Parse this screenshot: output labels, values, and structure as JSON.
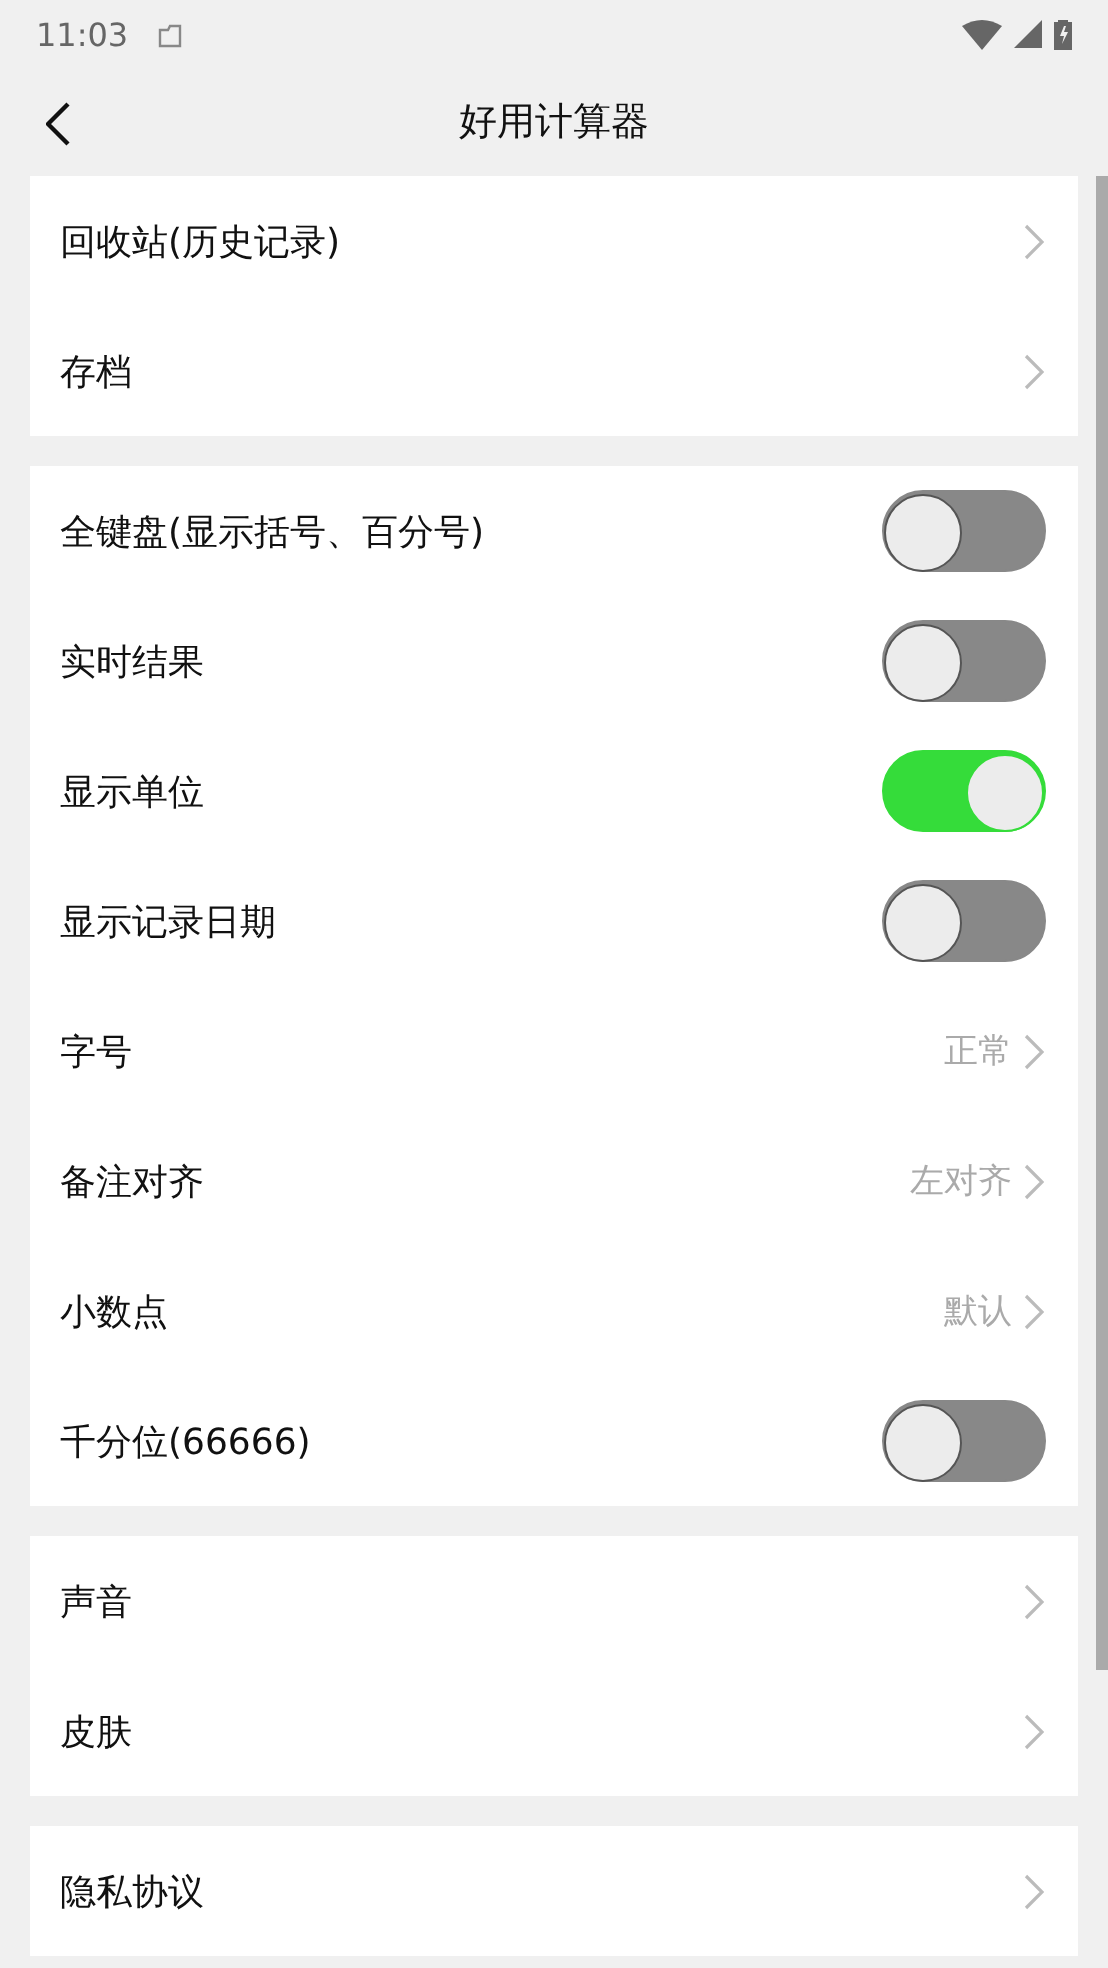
{
  "status_bar": {
    "time": "11:03"
  },
  "header": {
    "title": "好用计算器"
  },
  "groups": [
    {
      "rows": [
        {
          "kind": "link",
          "label": "回收站(历史记录)"
        },
        {
          "kind": "link",
          "label": "存档"
        }
      ]
    },
    {
      "rows": [
        {
          "kind": "toggle",
          "label": "全键盘(显示括号、百分号)",
          "on": false
        },
        {
          "kind": "toggle",
          "label": "实时结果",
          "on": false
        },
        {
          "kind": "toggle",
          "label": "显示单位",
          "on": true
        },
        {
          "kind": "toggle",
          "label": "显示记录日期",
          "on": false
        },
        {
          "kind": "value",
          "label": "字号",
          "value": "正常"
        },
        {
          "kind": "value",
          "label": "备注对齐",
          "value": "左对齐"
        },
        {
          "kind": "value",
          "label": "小数点",
          "value": "默认"
        },
        {
          "kind": "toggle",
          "label": "千分位(66666)",
          "on": false
        }
      ]
    },
    {
      "rows": [
        {
          "kind": "link",
          "label": "声音"
        },
        {
          "kind": "link",
          "label": "皮肤"
        }
      ]
    },
    {
      "rows": [
        {
          "kind": "link",
          "label": "隐私协议"
        }
      ]
    }
  ]
}
